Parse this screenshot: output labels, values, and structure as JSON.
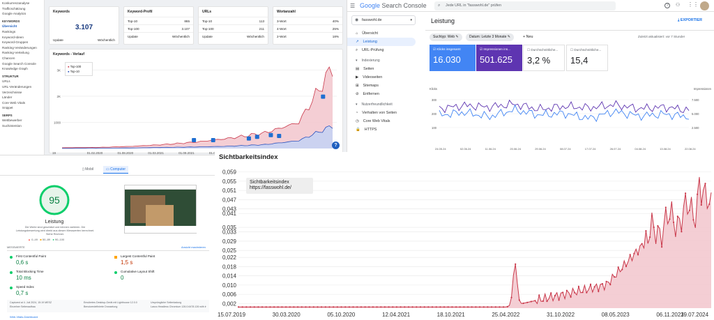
{
  "kw_tool": {
    "sidebar": {
      "items_top": [
        "Konkurrenzanalyse",
        "Trafficschätzung",
        "Google Analytics"
      ],
      "section_keywords": "KEYWORDS",
      "items_keywords": [
        "Übersicht",
        "Rankings",
        "Keyword-Ideen",
        "Keyword-Gruppen",
        "Ranking-Veränderungen",
        "Ranking-Verteilung",
        "Chancen",
        "Google Search Console",
        "Knowledge Graph"
      ],
      "section_struktur": "STRUKTUR",
      "items_struktur": [
        "URLs",
        "URL-Veränderungen",
        "Verzeichnisse",
        "Länder",
        "Core Web Vitals",
        "Snippet"
      ],
      "section_serps": "SERPS",
      "items_serps": [
        "Wettbewerber",
        "Suchintention"
      ]
    },
    "card_keywords": {
      "title": "Keywords",
      "value": "3.107",
      "footer_left": "Update",
      "footer_right": "Wöchentlich"
    },
    "card_profile": {
      "title": "Keyword-Profil",
      "rows": [
        [
          "Top-10",
          "865"
        ],
        [
          "Top-100",
          "3.107"
        ],
        [
          "Update",
          "Wöchentlich"
        ]
      ]
    },
    "card_urls": {
      "title": "URLs",
      "rows": [
        [
          "Top-10",
          "113"
        ],
        [
          "Top-100",
          "211"
        ],
        [
          "Update",
          "Wöchentlich"
        ]
      ]
    },
    "card_wortanzahl": {
      "title": "Wortanzahl",
      "rows": [
        [
          "3-Wort",
          "40%"
        ],
        [
          "4-Wort",
          "25%"
        ],
        [
          "2-Wort",
          "18%"
        ]
      ]
    },
    "chart_title": "Keywords - Verlauf",
    "legend": [
      "Top-100",
      "Top-10"
    ],
    "y_ticks": [
      "3K",
      "2K",
      "1000"
    ],
    "x_ticks": [
      "19",
      "01.02.2020",
      "01.08.2020",
      "01.03.2021",
      "01.09.2021",
      "01.04.2022",
      "01.10.2022",
      "01.05.2023",
      "13.11.2023",
      "26.07..."
    ],
    "help": "?"
  },
  "gsc": {
    "logo_google": "Google",
    "logo_rest": " Search Console",
    "search_placeholder": "Jede URL in \"fasswohl.de\" prüfen",
    "property": "fasswohl.de",
    "nav": [
      "Übersicht",
      "Leistung",
      "URL-Prüfung"
    ],
    "section_indexierung": "Indexierung",
    "nav_index": [
      "Seiten",
      "Videoseiten",
      "Sitemaps",
      "Entfernen"
    ],
    "section_nutzer": "Nutzerfreundlichkeit",
    "nav_nutzer": [
      "Verhalten von Seiten",
      "Core Web Vitals",
      "HTTPS"
    ],
    "page_title": "Leistung",
    "export": "EXPORTIER",
    "filters": [
      "Suchtyp: Web",
      "Datum: Letzte 3 Monate"
    ],
    "new_filter": "Neu",
    "updated": "Zuletzt aktualisiert: vor 7 Stunder",
    "metrics": [
      {
        "label": "Klicks insgesamt",
        "value": "16.030"
      },
      {
        "label": "Impressionen ins...",
        "value": "501.625"
      },
      {
        "label": "Durchschnittliche...",
        "value": "3,2 %"
      },
      {
        "label": "Durchschnittliche...",
        "value": "15,4"
      }
    ],
    "axis_left_label": "Klicks",
    "axis_right_label": "Impressionen",
    "y_left": [
      "300",
      "200",
      "100"
    ],
    "y_right": [
      "7.500",
      "5.000",
      "2.500"
    ],
    "x_dates": [
      "24.05.24",
      "02.06.24",
      "11.06.24",
      "20.06.24",
      "29.06.24",
      "08.07.24",
      "17.07.24",
      "26.07.24",
      "04.08.24",
      "13.08.24",
      "22.08.24"
    ]
  },
  "psi": {
    "tab_mobile": "Mobil",
    "tab_desktop": "Computer",
    "score": "95",
    "score_label": "Leistung",
    "note": "Die Werte sind geschätzt und können variieren. Die Leistungsbewertung wird direkt aus diesen Messwerten berechnet. Siehe Rechner.",
    "legend": [
      "0–49",
      "50–89",
      "90–100"
    ],
    "metrics_label": "MESSWERTE",
    "expand": "Ansicht maximieren",
    "metrics": [
      {
        "name": "First Contentful Paint",
        "value": "0,6 s"
      },
      {
        "name": "Largest Contentful Paint",
        "value": "1,5 s"
      },
      {
        "name": "Total Blocking Time",
        "value": "10 ms"
      },
      {
        "name": "Cumulative Layout Shift",
        "value": "0"
      },
      {
        "name": "Speed Index",
        "value": "0,7 s"
      }
    ],
    "footer": [
      "Captured at 4. Juli 2024, 15:19 MESZ",
      "Emuliertes Desktop-Gerät mit Lighthouse 12.0.0",
      "Einzelner Seitenaufbau",
      "Einzelne Seitenladung",
      "Benutzerdefinierte Drosselung",
      "Ursprüngliche Seitenladung",
      "Lanzu Headless Chromium 126.0.6478.126 with lr"
    ],
    "link": "Web-Vitals-Dashboard"
  },
  "sichtbarkeit": {
    "title": "Sichtbarkeitsindex",
    "tooltip_title": "Sichtbarkeitsindex",
    "tooltip_url": "https://fasswohl.de/",
    "accent": "#c9384a",
    "fill": "#f2c6cc"
  },
  "chart_data": [
    {
      "type": "line",
      "title": "Keywords - Verlauf",
      "series": [
        {
          "name": "Top-100",
          "x": [
            "01.02.2020",
            "01.08.2020",
            "01.03.2021",
            "01.09.2021",
            "01.04.2022",
            "01.10.2022",
            "01.05.2023",
            "13.11.2023",
            "26.07.2024"
          ],
          "values": [
            30,
            40,
            80,
            150,
            250,
            400,
            600,
            1000,
            3107
          ]
        },
        {
          "name": "Top-10",
          "x": [
            "01.02.2020",
            "01.08.2020",
            "01.03.2021",
            "01.09.2021",
            "01.04.2022",
            "01.10.2022",
            "01.05.2023",
            "13.11.2023",
            "26.07.2024"
          ],
          "values": [
            5,
            10,
            20,
            40,
            60,
            90,
            150,
            300,
            865
          ]
        }
      ],
      "ylim": [
        0,
        3200
      ]
    },
    {
      "type": "line",
      "title": "Leistung",
      "series": [
        {
          "name": "Klicks insgesamt",
          "values": [
            180,
            195,
            170,
            210,
            180,
            190,
            160,
            200,
            175,
            185,
            170
          ]
        },
        {
          "name": "Impressionen insgesamt",
          "values": [
            5600,
            6000,
            5800,
            6200,
            5500,
            5900,
            5700,
            6100,
            5600,
            5800,
            5400
          ]
        }
      ],
      "x": [
        "24.05.24",
        "02.06.24",
        "11.06.24",
        "20.06.24",
        "29.06.24",
        "08.07.24",
        "17.07.24",
        "26.07.24",
        "04.08.24",
        "13.08.24",
        "22.08.24"
      ]
    },
    {
      "type": "area",
      "title": "Sichtbarkeitsindex",
      "x": [
        "15.07.2019",
        "30.03.2020",
        "05.10.2020",
        "12.04.2021",
        "18.10.2021",
        "25.04.2022",
        "31.10.2022",
        "08.05.2023",
        "06.11.2023",
        "19.07.2024"
      ],
      "series": [
        {
          "name": "Sichtbarkeitsindex",
          "values": [
            0.0,
            0.0,
            0.0,
            0.0,
            0.0,
            0.0,
            0.005,
            0.01,
            0.035,
            0.047
          ]
        }
      ],
      "y_ticks": [
        0.059,
        0.055,
        0.051,
        0.047,
        0.043,
        0.041,
        0.035,
        0.033,
        0.029,
        0.025,
        0.022,
        0.018,
        0.014,
        0.01,
        0.006,
        0.002
      ],
      "ylim": [
        0,
        0.061
      ]
    }
  ]
}
